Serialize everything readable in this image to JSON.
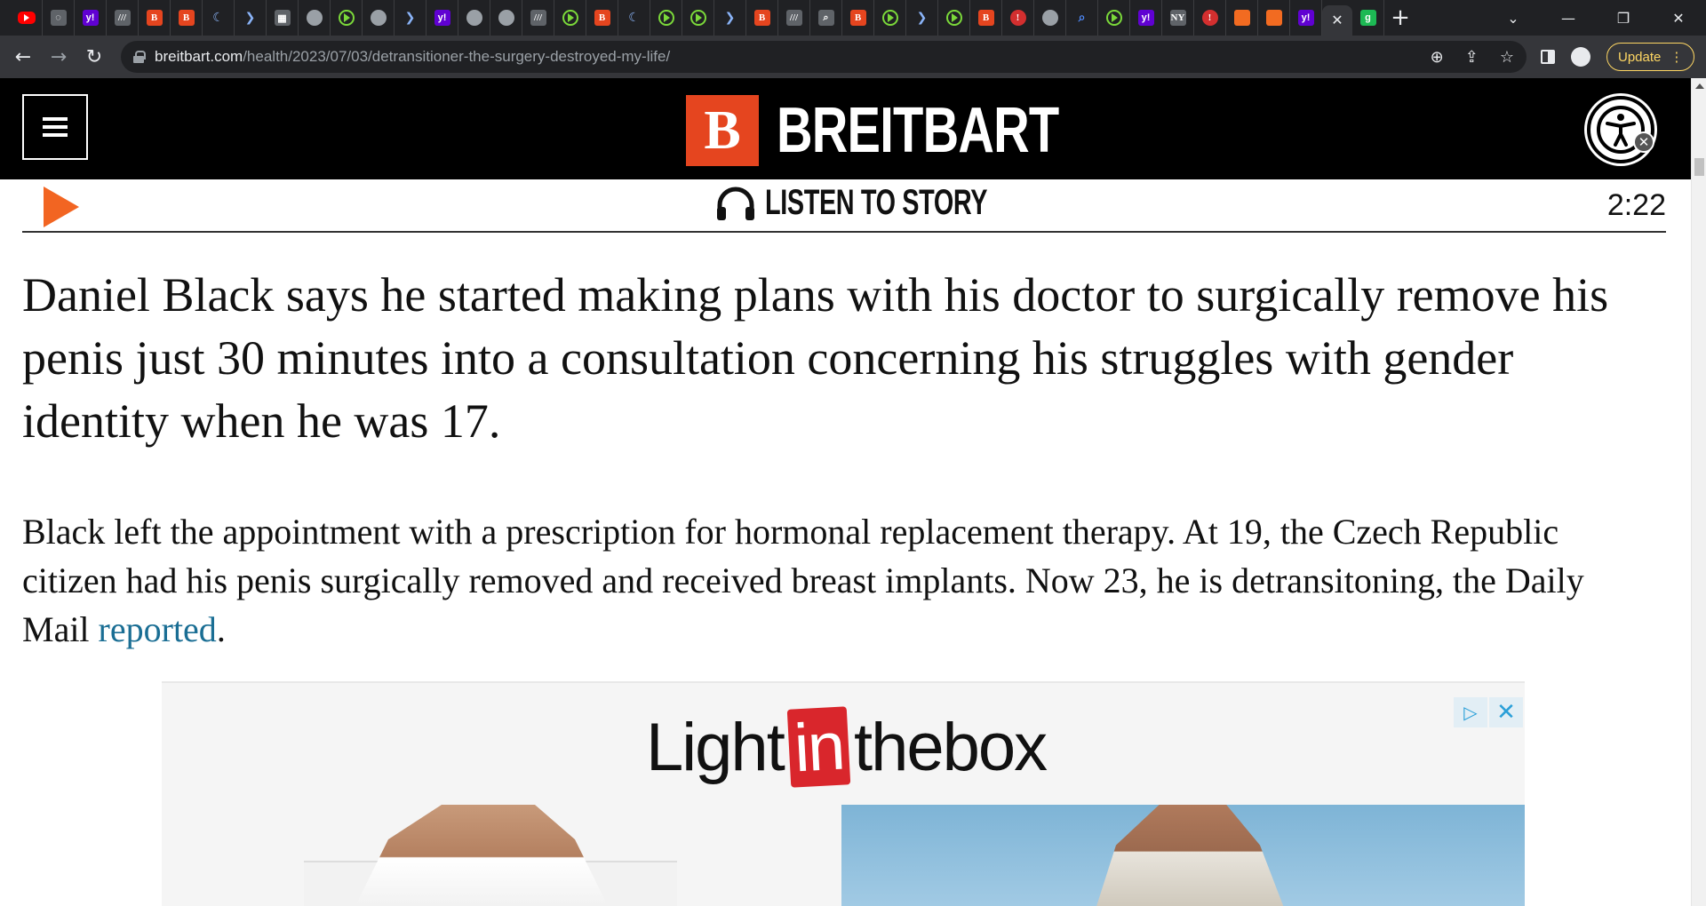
{
  "browser": {
    "tab_favicons": [
      {
        "name": "youtube",
        "glyph": "",
        "cls": "yt"
      },
      {
        "name": "shield",
        "glyph": "◌",
        "cls": "gry"
      },
      {
        "name": "yahoo",
        "glyph": "y!",
        "cls": "yh"
      },
      {
        "name": "news",
        "glyph": "///",
        "cls": "gry"
      },
      {
        "name": "breitbart",
        "glyph": "B",
        "cls": "bb"
      },
      {
        "name": "breitbart",
        "glyph": "B",
        "cls": "bb"
      },
      {
        "name": "moon",
        "glyph": "☾",
        "cls": "arr"
      },
      {
        "name": "arrow",
        "glyph": "❯",
        "cls": "arr"
      },
      {
        "name": "grid",
        "glyph": "▦",
        "cls": "gry"
      },
      {
        "name": "globe",
        "glyph": "",
        "cls": "glb"
      },
      {
        "name": "play",
        "glyph": "",
        "cls": "play"
      },
      {
        "name": "globe",
        "glyph": "",
        "cls": "glb"
      },
      {
        "name": "arrow",
        "glyph": "❯",
        "cls": "arr"
      },
      {
        "name": "yahoo",
        "glyph": "y!",
        "cls": "yh"
      },
      {
        "name": "globe",
        "glyph": "",
        "cls": "glb"
      },
      {
        "name": "globe",
        "glyph": "",
        "cls": "glb"
      },
      {
        "name": "news",
        "glyph": "///",
        "cls": "gry"
      },
      {
        "name": "play",
        "glyph": "",
        "cls": "play"
      },
      {
        "name": "breitbart",
        "glyph": "B",
        "cls": "bb"
      },
      {
        "name": "moon",
        "glyph": "☾",
        "cls": "arr"
      },
      {
        "name": "play",
        "glyph": "",
        "cls": "play"
      },
      {
        "name": "play",
        "glyph": "",
        "cls": "play"
      },
      {
        "name": "arrow",
        "glyph": "❯",
        "cls": "arr"
      },
      {
        "name": "breitbart",
        "glyph": "B",
        "cls": "bb"
      },
      {
        "name": "news",
        "glyph": "///",
        "cls": "gry"
      },
      {
        "name": "search",
        "glyph": "⌕",
        "cls": "gry"
      },
      {
        "name": "breitbart",
        "glyph": "B",
        "cls": "bb"
      },
      {
        "name": "play",
        "glyph": "",
        "cls": "play"
      },
      {
        "name": "arrow",
        "glyph": "❯",
        "cls": "arr"
      },
      {
        "name": "play",
        "glyph": "",
        "cls": "play"
      },
      {
        "name": "breitbart",
        "glyph": "B",
        "cls": "bb"
      },
      {
        "name": "red-pin",
        "glyph": "!",
        "cls": "red"
      },
      {
        "name": "globe",
        "glyph": "",
        "cls": "glb"
      },
      {
        "name": "search",
        "glyph": "⌕",
        "cls": "blu"
      },
      {
        "name": "play",
        "glyph": "",
        "cls": "play"
      },
      {
        "name": "yahoo",
        "glyph": "y!",
        "cls": "yh"
      },
      {
        "name": "news",
        "glyph": "NY",
        "cls": "gry"
      },
      {
        "name": "red-pin",
        "glyph": "!",
        "cls": "red"
      },
      {
        "name": "bookmark",
        "glyph": "",
        "cls": "ora"
      },
      {
        "name": "bookmark",
        "glyph": "",
        "cls": "ora"
      },
      {
        "name": "yahoo",
        "glyph": "y!",
        "cls": "yh"
      }
    ],
    "active_tab_close": "✕",
    "extra_tab_glyph": "g",
    "new_tab": "+",
    "url_host": "breitbart.com",
    "url_path": "/health/2023/07/03/detransitioner-the-surgery-destroyed-my-life/",
    "update_label": "Update"
  },
  "site": {
    "brand_mark": "B",
    "brand_name": "BREITBART",
    "listen_label": "LISTEN TO STORY",
    "duration": "2:22"
  },
  "article": {
    "lede": "Daniel Black says he started making plans with his doctor to surgically remove his penis just 30 minutes into a consultation concerning his struggles with gender identity when he was 17.",
    "para_before_link": "Black left the appointment with a prescription for hormonal replacement therapy. At 19, the Czech Republic citizen had his penis surgically removed and received breast implants. Now 23, he is detransitoning, the Daily Mail ",
    "para_link": "reported",
    "para_after_link": "."
  },
  "ad": {
    "brand_left": "Light",
    "brand_in": "in",
    "brand_right": "thebox",
    "adchoices_glyph": "▷",
    "close_glyph": "✕"
  }
}
